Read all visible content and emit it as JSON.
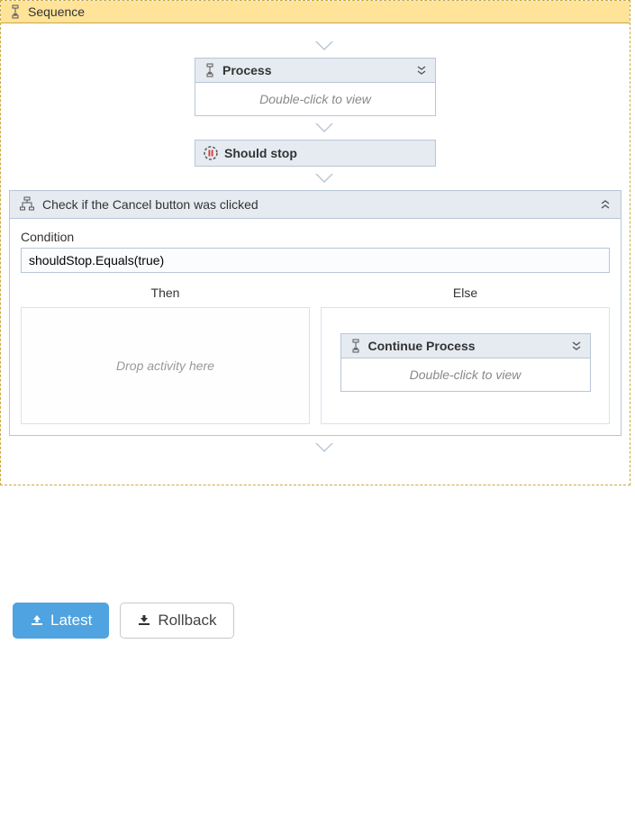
{
  "sequence": {
    "title": "Sequence"
  },
  "process": {
    "title": "Process",
    "body": "Double-click to view"
  },
  "shouldStop": {
    "title": "Should stop"
  },
  "ifActivity": {
    "title": "Check if the Cancel button was clicked",
    "conditionLabel": "Condition",
    "conditionValue": "shouldStop.Equals(true)",
    "thenLabel": "Then",
    "elseLabel": "Else",
    "thenPlaceholder": "Drop activity here"
  },
  "continueProcess": {
    "title": "Continue Process",
    "body": "Double-click to view"
  },
  "buttons": {
    "latest": "Latest",
    "rollback": "Rollback"
  }
}
